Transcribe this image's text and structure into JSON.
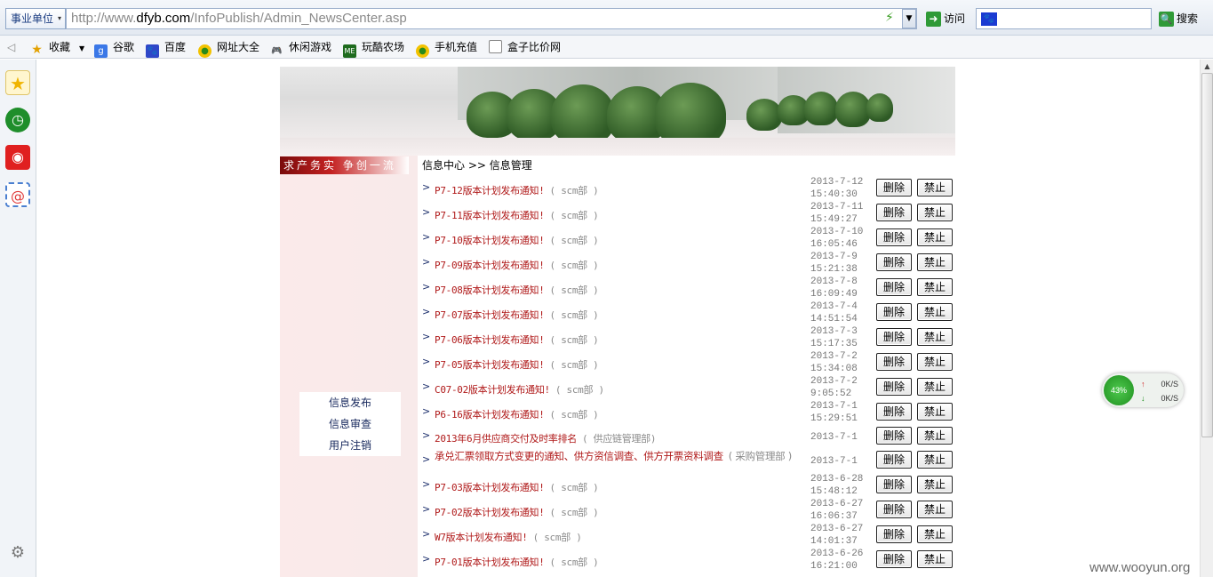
{
  "browser": {
    "category": "事业单位",
    "url_prefix": "http://www.",
    "url_domain": "dfyb.com",
    "url_path": "/InfoPublish/Admin_NewsCenter.asp",
    "go_label": "访问",
    "search_value": "",
    "search_label": "搜索"
  },
  "favorites": [
    "收藏",
    "谷歌",
    "百度",
    "网址大全",
    "休闲游戏",
    "玩酷农场",
    "手机充值",
    "盒子比价网"
  ],
  "page": {
    "slogan": "求产务实 争创一流",
    "breadcrumb": "信息中心 >> 信息管理",
    "left_menu": [
      "信息发布",
      "信息审查",
      "用户注销"
    ],
    "delete_label": "删除",
    "ban_label": "禁止",
    "news": [
      {
        "title": "P7-12版本计划发布通知!",
        "source": "( scm部 )",
        "date": "2013-7-12",
        "time": "15:40:30"
      },
      {
        "title": "P7-11版本计划发布通知!",
        "source": "( scm部 )",
        "date": "2013-7-11",
        "time": "15:49:27"
      },
      {
        "title": "P7-10版本计划发布通知!",
        "source": "( scm部 )",
        "date": "2013-7-10",
        "time": "16:05:46"
      },
      {
        "title": "P7-09版本计划发布通知!",
        "source": "( scm部 )",
        "date": "2013-7-9",
        "time": "15:21:38"
      },
      {
        "title": "P7-08版本计划发布通知!",
        "source": "( scm部 )",
        "date": "2013-7-8",
        "time": "16:09:49"
      },
      {
        "title": "P7-07版本计划发布通知!",
        "source": "( scm部 )",
        "date": "2013-7-4",
        "time": "14:51:54"
      },
      {
        "title": "P7-06版本计划发布通知!",
        "source": "( scm部 )",
        "date": "2013-7-3",
        "time": "15:17:35"
      },
      {
        "title": "P7-05版本计划发布通知!",
        "source": "( scm部 )",
        "date": "2013-7-2",
        "time": "15:34:08"
      },
      {
        "title": "C07-02版本计划发布通知!",
        "source": "( scm部 )",
        "date": "2013-7-2",
        "time": "9:05:52"
      },
      {
        "title": "P6-16版本计划发布通知!",
        "source": "( scm部 )",
        "date": "2013-7-1",
        "time": "15:29:51"
      },
      {
        "title": "2013年6月供应商交付及时率排名",
        "source": "( 供应链管理部)",
        "date": "2013-7-1",
        "time": ""
      },
      {
        "title": "承兑汇票领取方式变更的通知、供方资信调查、供方开票资料调查",
        "source": "( 采购管理部 )",
        "date": "2013-7-1",
        "time": ""
      },
      {
        "title": "P7-03版本计划发布通知!",
        "source": "( scm部 )",
        "date": "2013-6-28",
        "time": "15:48:12"
      },
      {
        "title": "P7-02版本计划发布通知!",
        "source": "( scm部 )",
        "date": "2013-6-27",
        "time": "16:06:37"
      },
      {
        "title": "W7版本计划发布通知!",
        "source": "( scm部 )",
        "date": "2013-6-27",
        "time": "14:01:37"
      },
      {
        "title": "P7-01版本计划发布通知!",
        "source": "( scm部 )",
        "date": "2013-6-26",
        "time": "16:21:00"
      }
    ]
  },
  "speed_widget": {
    "percent": "43%",
    "up": "0K/S",
    "down": "0K/S"
  },
  "watermark": "www.wooyun.org"
}
